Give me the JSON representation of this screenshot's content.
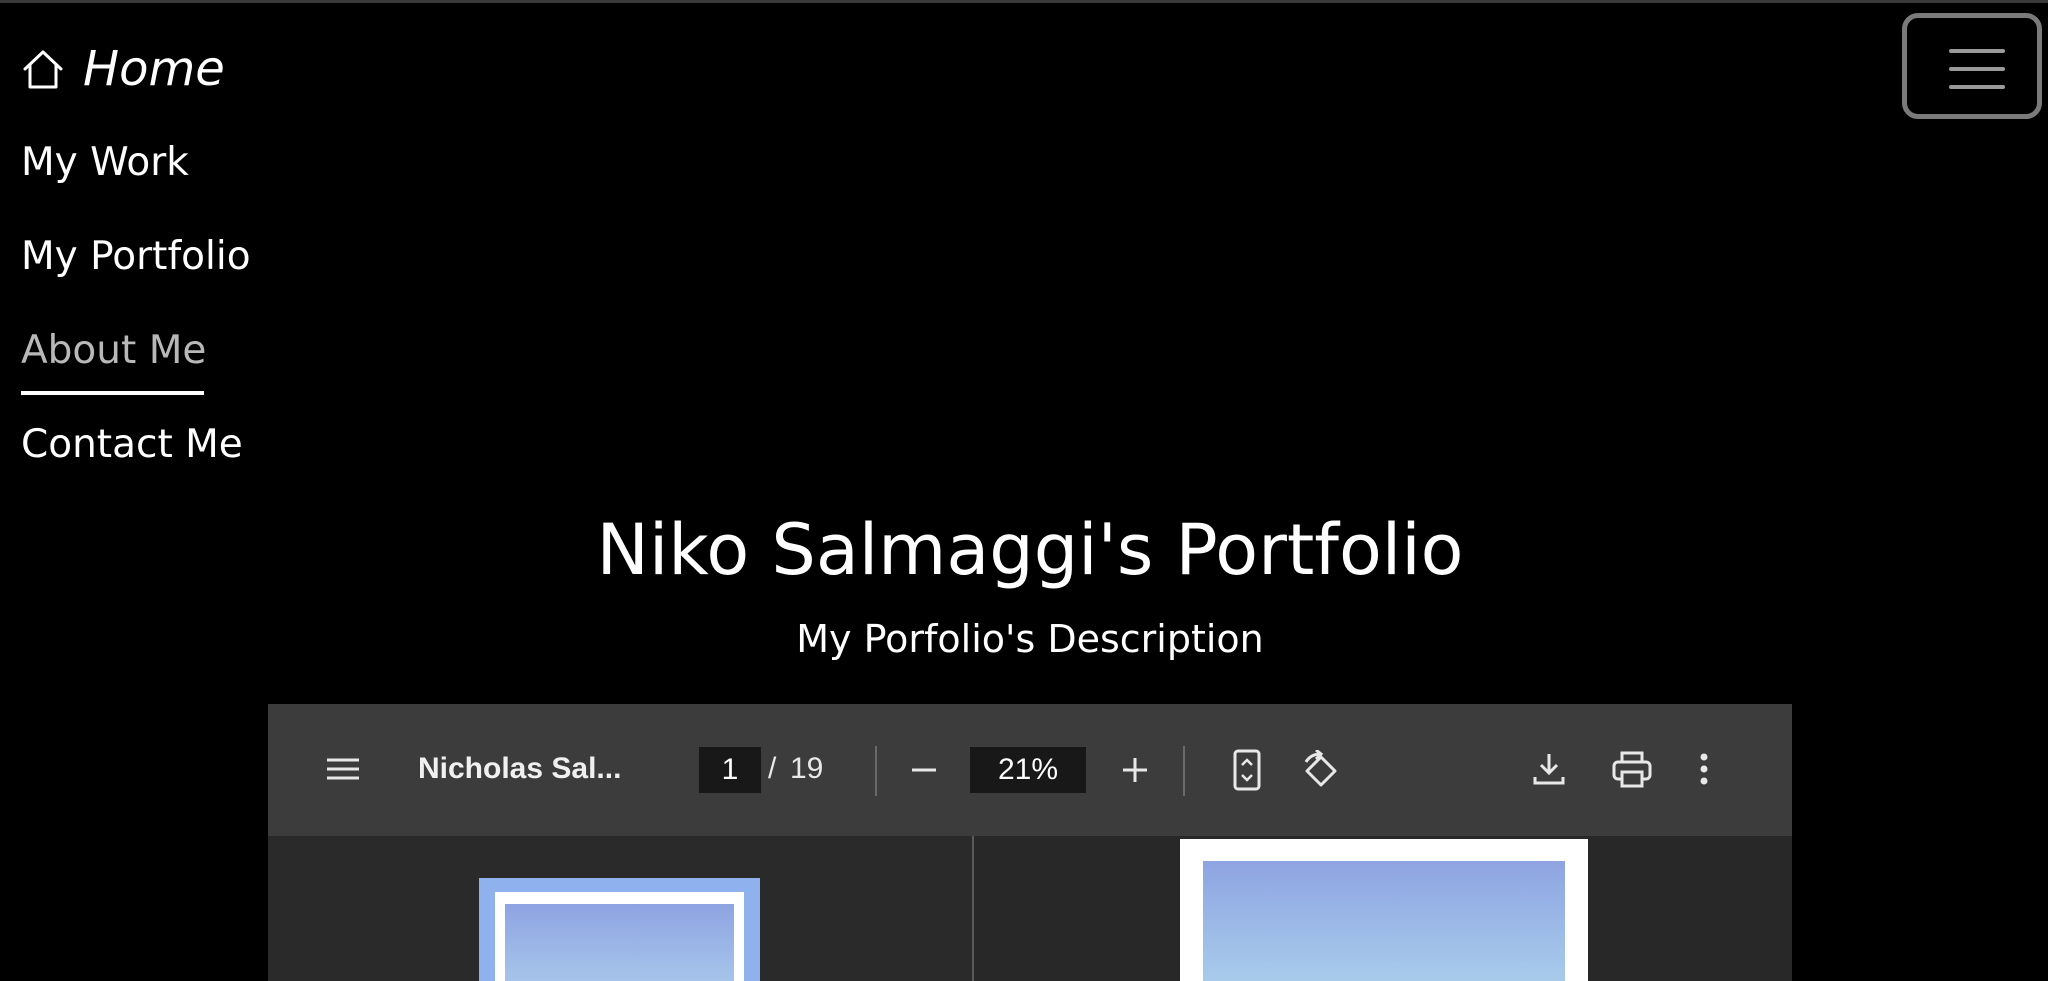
{
  "nav": {
    "home_label": "Home",
    "links": [
      {
        "label": "My Work",
        "active": false
      },
      {
        "label": "My Portfolio",
        "active": false
      },
      {
        "label": "About Me",
        "active": true
      },
      {
        "label": "Contact Me",
        "active": false
      }
    ],
    "menu_icon": "hamburger-menu-icon"
  },
  "header": {
    "title": "Niko Salmaggi's Portfolio",
    "subtitle": "My Porfolio's Description"
  },
  "pdf_viewer": {
    "document_name": "Nicholas Sal...",
    "current_page": "1",
    "page_separator": "/",
    "total_pages": "19",
    "zoom": "21%",
    "icons": [
      "menu-icon",
      "zoom-out-icon",
      "zoom-in-icon",
      "fit-page-icon",
      "rotate-icon",
      "download-icon",
      "print-icon",
      "more-options-icon"
    ]
  },
  "colors": {
    "background": "#000000",
    "toolbar": "#3c3c3c",
    "viewer_bg": "#282828",
    "active_link": "#b8b8b8",
    "thumbnail_highlight": "#8fb2ee"
  }
}
